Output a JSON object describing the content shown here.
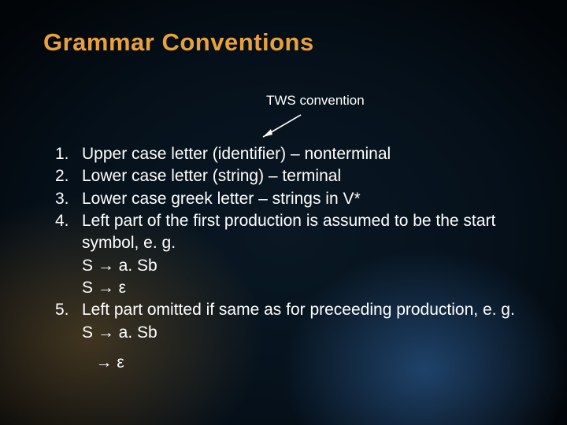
{
  "title": "Grammar Conventions",
  "subtitle": "TWS convention",
  "items": [
    {
      "n": "1.",
      "text": "Upper case letter (identifier) – nonterminal"
    },
    {
      "n": "2.",
      "text": "Lower case letter (string) – terminal"
    },
    {
      "n": "3.",
      "text": "Lower case greek letter – strings in V*"
    },
    {
      "n": "4.",
      "text": "Left part of the first production is assumed to be the start symbol, e. g."
    },
    {
      "n": "",
      "text": "S → a. Sb",
      "sub": true
    },
    {
      "n": "",
      "text": "S → ε",
      "sub": true
    },
    {
      "n": "5.",
      "text": "Left part omitted if same as for preceeding production, e. g."
    },
    {
      "n": "",
      "text": "S → a. Sb",
      "sub": true
    },
    {
      "n": "",
      "text": "   → ε",
      "sub": true,
      "gap": true
    }
  ]
}
